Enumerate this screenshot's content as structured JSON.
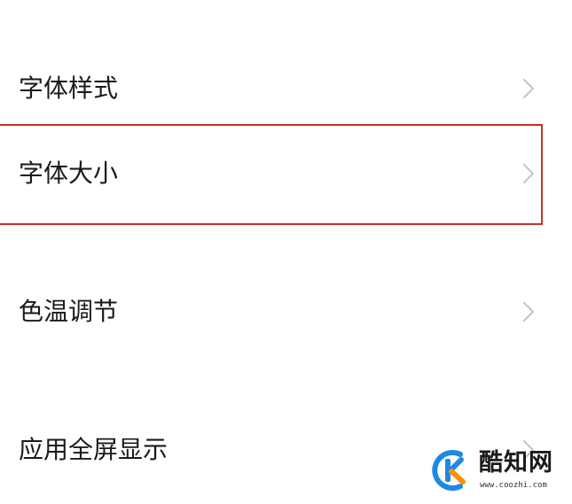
{
  "settings": {
    "items": [
      {
        "label": "字体样式",
        "icon": "chevron-right-icon"
      },
      {
        "label": "字体大小",
        "icon": "chevron-right-icon",
        "highlighted": true
      },
      {
        "label": "色温调节",
        "icon": "chevron-right-icon"
      },
      {
        "label": "应用全屏显示",
        "icon": "chevron-right-icon"
      }
    ]
  },
  "annotation": {
    "highlight_color": "#c9302c"
  },
  "watermark": {
    "brand": "酷知网",
    "url": "www.coozhi.com",
    "logo_colors": [
      "#1e88e5",
      "#ff8f00"
    ]
  }
}
